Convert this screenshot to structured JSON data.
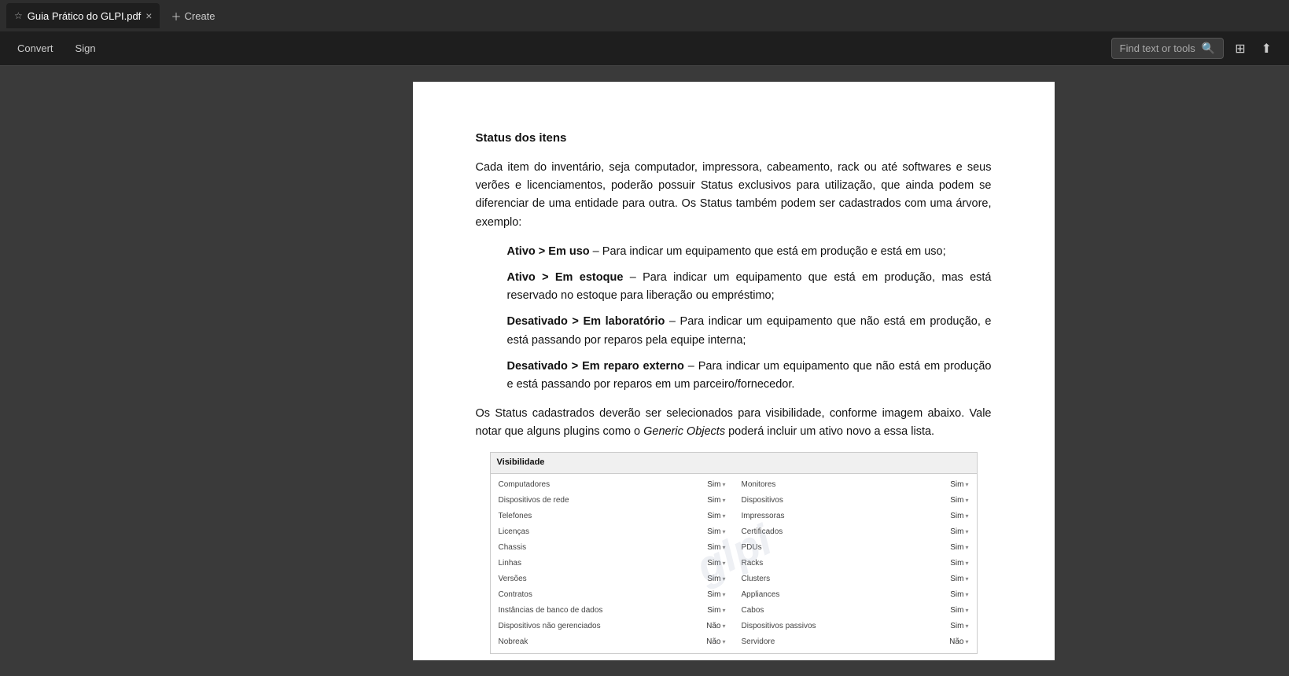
{
  "tabs": [
    {
      "label": "Guia Prático do GLPI.pdf",
      "active": true
    },
    {
      "label": "Create",
      "active": false
    }
  ],
  "toolbar": {
    "convert_label": "Convert",
    "sign_label": "Sign",
    "find_placeholder": "Find text or tools"
  },
  "page": {
    "section_title": "Status dos itens",
    "paragraph1": "Cada item do inventário, seja computador, impressora, cabeamento, rack ou até softwares e seus verões e licenciamentos, poderão possuir Status exclusivos para utilização, que ainda podem se diferenciar de uma entidade para outra. Os Status também podem ser cadastrados com uma árvore, exemplo:",
    "bullets": [
      {
        "bold": "Ativo > Em uso",
        "text": " – Para indicar um equipamento que está em produção e está em uso;"
      },
      {
        "bold": "Ativo > Em estoque",
        "text": " – Para indicar um equipamento que está em produção, mas está reservado no estoque para liberação ou empréstimo;"
      },
      {
        "bold": "Desativado > Em laboratório",
        "text": " – Para indicar um equipamento que não está em produção, e está passando por reparos pela equipe interna;"
      },
      {
        "bold": "Desativado > Em reparo externo",
        "text": " – Para indicar um equipamento que não está em produção e está passando por reparos em um parceiro/fornecedor."
      }
    ],
    "paragraph2_start": "Os Status cadastrados deverão ser selecionados para visibilidade, conforme imagem abaixo. Vale notar que alguns plugins como o ",
    "paragraph2_italic": "Generic Objects",
    "paragraph2_end": " poderá incluir um ativo novo a essa lista.",
    "visibility_table": {
      "header": "Visibilidade",
      "left_items": [
        {
          "label": "Computadores",
          "value": "Sim"
        },
        {
          "label": "Dispositivos de rede",
          "value": "Sim"
        },
        {
          "label": "Telefones",
          "value": "Sim"
        },
        {
          "label": "Licenças",
          "value": "Sim"
        },
        {
          "label": "Chassis",
          "value": "Sim"
        },
        {
          "label": "Linhas",
          "value": "Sim"
        },
        {
          "label": "Versões",
          "value": "Sim"
        },
        {
          "label": "Contratos",
          "value": "Sim"
        },
        {
          "label": "Instâncias de banco de dados",
          "value": "Sim"
        },
        {
          "label": "Dispositivos não gerenciados",
          "value": "Não"
        },
        {
          "label": "Nobreak",
          "value": "Não"
        }
      ],
      "right_items": [
        {
          "label": "Monitores",
          "value": "Sim"
        },
        {
          "label": "Dispositivos",
          "value": "Sim"
        },
        {
          "label": "Impressoras",
          "value": "Sim"
        },
        {
          "label": "Certificados",
          "value": "Sim"
        },
        {
          "label": "PDUs",
          "value": "Sim"
        },
        {
          "label": "Racks",
          "value": "Sim"
        },
        {
          "label": "Clusters",
          "value": "Sim"
        },
        {
          "label": "Appliances",
          "value": "Sim"
        },
        {
          "label": "Cabos",
          "value": "Sim"
        },
        {
          "label": "Dispositivos passivos",
          "value": "Sim"
        },
        {
          "label": "Servidore",
          "value": "Não"
        }
      ]
    }
  }
}
